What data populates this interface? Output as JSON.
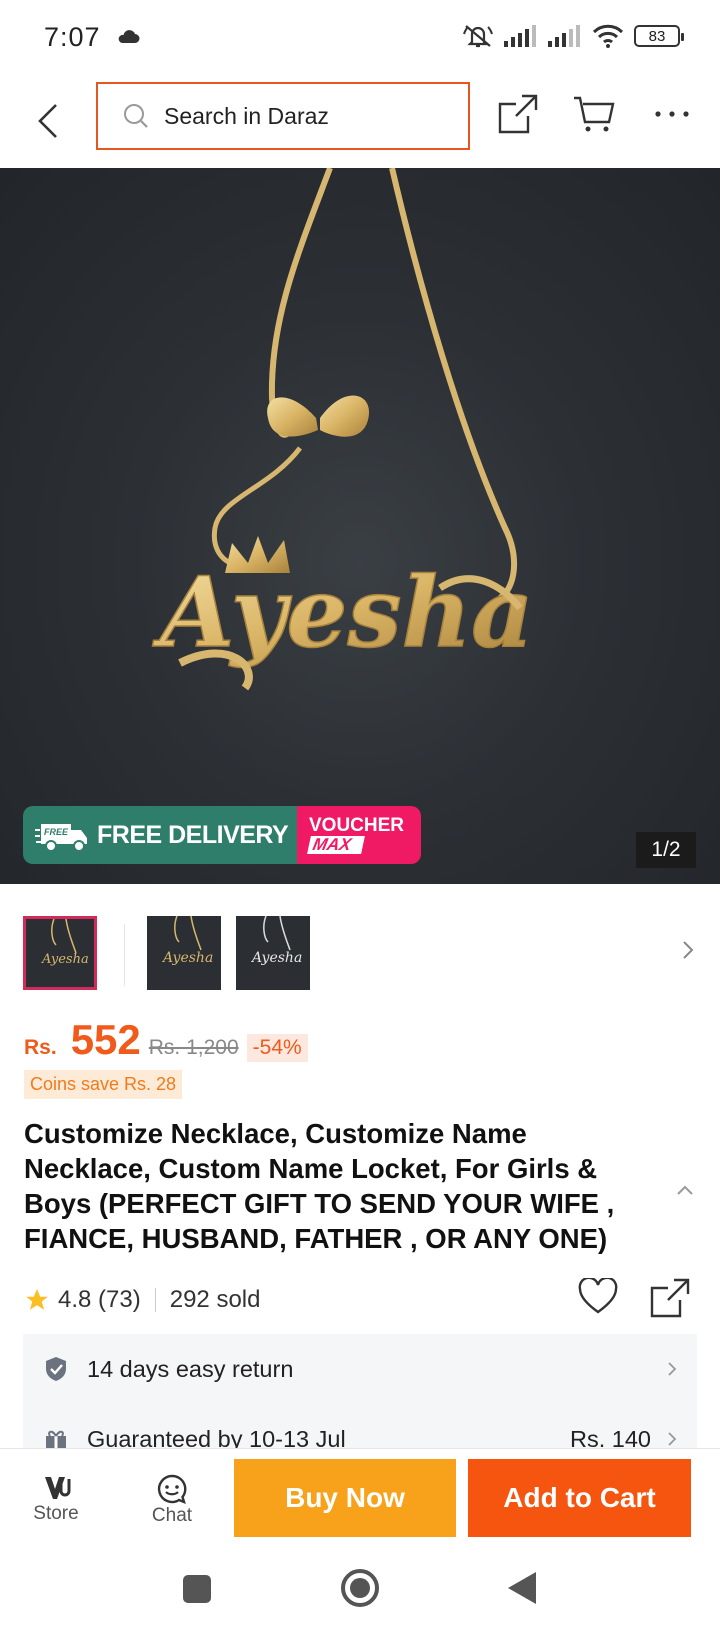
{
  "status_bar": {
    "time": "7:07",
    "battery": "83",
    "icons": [
      "cloud-icon",
      "mute-icon",
      "signal-icon",
      "signal-icon",
      "wifi-icon",
      "battery-icon"
    ]
  },
  "header": {
    "search_placeholder": "Search in Daraz",
    "icons": [
      "back-arrow-icon",
      "search-icon",
      "share-icon",
      "cart-icon",
      "more-icon"
    ]
  },
  "gallery": {
    "counter": "1/2",
    "promo_free_badge": "FREE",
    "promo_free_delivery": "FREE DELIVERY",
    "promo_voucher": "VOUCHER",
    "promo_max": "MAX",
    "image_text": "Ayesha",
    "thumbnail_count": 3
  },
  "price": {
    "currency": "Rs.",
    "value": "552",
    "original": "Rs. 1,200",
    "discount": "-54%",
    "coins": "Coins save Rs. 28"
  },
  "product": {
    "title": "Customize Necklace, Customize Name Necklace, Custom Name Locket, For Girls & Boys (PERFECT GIFT TO SEND YOUR WIFE , FIANCE, HUSBAND, FATHER , OR ANY ONE)",
    "rating": "4.8",
    "reviews": "(73)",
    "sold": "292 sold"
  },
  "info": {
    "return_policy": "14 days easy return",
    "delivery": "Guaranteed by 10-13 Jul",
    "delivery_fee": "Rs. 140"
  },
  "actions": {
    "store_label": "Store",
    "chat_label": "Chat",
    "buy_now": "Buy Now",
    "add_to_cart": "Add to Cart"
  },
  "colors": {
    "accent_orange": "#f05a1a",
    "buy_now": "#f8a11a",
    "add_to_cart": "#f5550f",
    "free_delivery_green": "#2f7e6b",
    "voucher_pink": "#f01a64"
  }
}
